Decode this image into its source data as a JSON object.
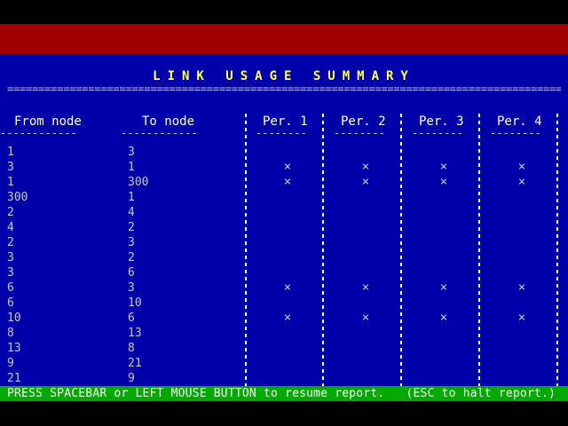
{
  "report": {
    "title": "LINK USAGE SUMMARY",
    "rule": "==============================================================================================================="
  },
  "columns": {
    "from_node": "From node",
    "to_node": "To node",
    "per1": "Per. 1",
    "per2": "Per. 2",
    "per3": "Per. 3",
    "per4": "Per. 4",
    "from_underline": "------------",
    "to_underline": "------------",
    "per_underline": "--------"
  },
  "rows": [
    {
      "from": "1",
      "to": "3",
      "per": [
        "",
        "",
        "",
        ""
      ]
    },
    {
      "from": "3",
      "to": "1",
      "per": [
        "×",
        "×",
        "×",
        "×"
      ]
    },
    {
      "from": "1",
      "to": "300",
      "per": [
        "×",
        "×",
        "×",
        "×"
      ]
    },
    {
      "from": "300",
      "to": "1",
      "per": [
        "",
        "",
        "",
        ""
      ]
    },
    {
      "from": "2",
      "to": "4",
      "per": [
        "",
        "",
        "",
        ""
      ]
    },
    {
      "from": "4",
      "to": "2",
      "per": [
        "",
        "",
        "",
        ""
      ]
    },
    {
      "from": "2",
      "to": "3",
      "per": [
        "",
        "",
        "",
        ""
      ]
    },
    {
      "from": "3",
      "to": "2",
      "per": [
        "",
        "",
        "",
        ""
      ]
    },
    {
      "from": "3",
      "to": "6",
      "per": [
        "",
        "",
        "",
        ""
      ]
    },
    {
      "from": "6",
      "to": "3",
      "per": [
        "×",
        "×",
        "×",
        "×"
      ]
    },
    {
      "from": "6",
      "to": "10",
      "per": [
        "",
        "",
        "",
        ""
      ]
    },
    {
      "from": "10",
      "to": "6",
      "per": [
        "×",
        "×",
        "×",
        "×"
      ]
    },
    {
      "from": "8",
      "to": "13",
      "per": [
        "",
        "",
        "",
        ""
      ]
    },
    {
      "from": "13",
      "to": "8",
      "per": [
        "",
        "",
        "",
        ""
      ]
    },
    {
      "from": "9",
      "to": "21",
      "per": [
        "",
        "",
        "",
        ""
      ]
    },
    {
      "from": "21",
      "to": "9",
      "per": [
        "",
        "",
        "",
        ""
      ]
    }
  ],
  "status": {
    "message": "PRESS SPACEBAR or LEFT MOUSE BUTTON to resume report.   (ESC to halt report.)"
  },
  "colors": {
    "background_blue": "#0000aa",
    "top_band_red": "#a00000",
    "status_green": "#00aa00",
    "title_yellow": "#ffff55"
  }
}
